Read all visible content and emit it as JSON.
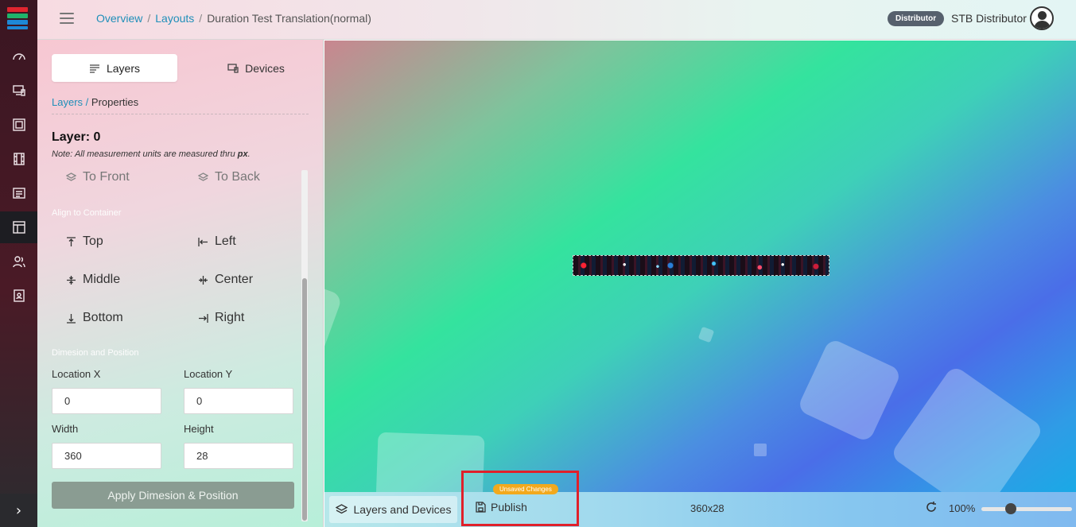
{
  "topbar": {
    "breadcrumb": [
      "Overview",
      "Layouts",
      "Duration Test Translation(normal)"
    ],
    "role_badge": "Distributor",
    "user_name": "STB Distributor"
  },
  "sidebar": {
    "items": [
      {
        "icon": "dashboard-icon"
      },
      {
        "icon": "devices-icon"
      },
      {
        "icon": "media-icon"
      },
      {
        "icon": "film-icon"
      },
      {
        "icon": "list-icon"
      },
      {
        "icon": "layout-icon",
        "active": true
      },
      {
        "icon": "users-icon"
      },
      {
        "icon": "contacts-icon"
      }
    ],
    "expand_icon": "chevron-right-icon"
  },
  "panel": {
    "tabs": [
      {
        "label": "Layers",
        "icon": "layers-list-icon",
        "active": true
      },
      {
        "label": "Devices",
        "icon": "devices-icon"
      }
    ],
    "subcrumb": {
      "link": "Layers",
      "separator": "/",
      "current": "Properties"
    },
    "layer_title": "Layer: 0",
    "note_prefix": "Note: All measurement units are measured thru ",
    "note_unit": "px",
    "note_suffix": ".",
    "order": {
      "to_front": "To Front",
      "to_back": "To Back"
    },
    "align_label": "Align to Container",
    "align": {
      "top": "Top",
      "left": "Left",
      "middle": "Middle",
      "center": "Center",
      "bottom": "Bottom",
      "right": "Right"
    },
    "dimension_label": "Dimesion and Position",
    "fields": {
      "location_x": {
        "label": "Location X",
        "value": "0"
      },
      "location_y": {
        "label": "Location Y",
        "value": "0"
      },
      "width": {
        "label": "Width",
        "value": "360"
      },
      "height": {
        "label": "Height",
        "value": "28"
      }
    },
    "apply_label": "Apply Dimesion & Position"
  },
  "bottombar": {
    "layers_devices_label": "Layers and Devices",
    "publish_label": "Publish",
    "unsaved_badge": "Unsaved Changes",
    "dimensions": "360x28",
    "zoom": "100%",
    "zoom_level": 0.3
  },
  "colors": {
    "accent_link": "#1f8fb9",
    "highlight": "#e0202a",
    "unsaved": "#f2a91d"
  }
}
